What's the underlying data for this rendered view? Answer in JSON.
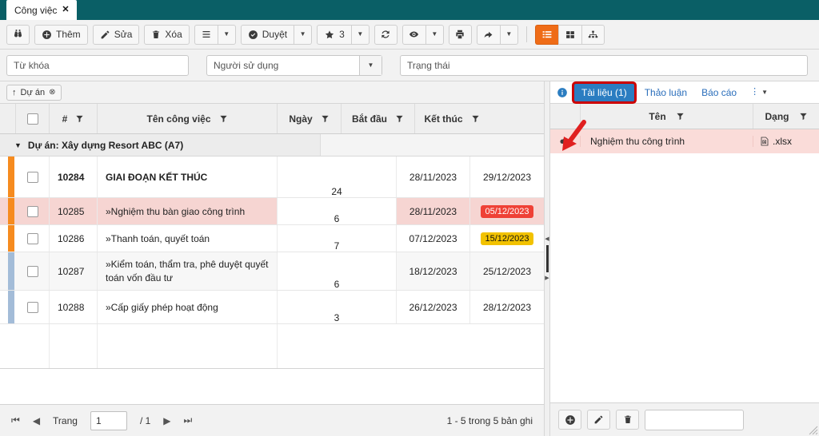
{
  "window": {
    "tab_title": "Công việc",
    "tab_close": "✕"
  },
  "toolbar": {
    "search_icon": "binoculars-icon",
    "add_label": "Thêm",
    "edit_label": "Sửa",
    "delete_label": "Xóa",
    "menu_icon": "hamburger-icon",
    "approve_label": "Duyệt",
    "star_count": "3",
    "refresh_icon": "refresh-icon",
    "eye_icon": "eye-icon",
    "print_icon": "printer-icon",
    "share_icon": "share-arrow-icon",
    "view_list_icon": "list-view-icon",
    "view_grid_icon": "grid-view-icon",
    "view_tree_icon": "tree-view-icon",
    "caret": "▼"
  },
  "filters": {
    "keyword_placeholder": "Từ khóa",
    "keyword_value": "",
    "user_value": "Người sử dụng",
    "status_value": "Trạng thái"
  },
  "group_chip": {
    "arrow": "↑",
    "label": "Dự án",
    "close": "✕"
  },
  "grid": {
    "columns": {
      "num": "#",
      "name": "Tên công việc",
      "days": "Ngày",
      "start": "Bắt đầu",
      "end": "Kết thúc"
    },
    "group_label": "Dự án: Xây dựng Resort ABC (A7)",
    "group_toggle": "▼",
    "rows": [
      {
        "id": "10284",
        "name": "GIAI ĐOẠN KẾT THÚC",
        "days": "24",
        "start": "28/11/2023",
        "end": "29/12/2023",
        "bold": true,
        "bar": "orange",
        "highlight": "none",
        "end_badge": "none"
      },
      {
        "id": "10285",
        "name": "»Nghiệm thu bàn giao công trình",
        "days": "6",
        "start": "28/11/2023",
        "end": "05/12/2023",
        "bold": false,
        "bar": "orange",
        "highlight": "selected",
        "end_badge": "red"
      },
      {
        "id": "10286",
        "name": "»Thanh toán, quyết toán",
        "days": "7",
        "start": "07/12/2023",
        "end": "15/12/2023",
        "bold": false,
        "bar": "orange",
        "highlight": "none",
        "end_badge": "yellow"
      },
      {
        "id": "10287",
        "name": "»Kiểm toán, thẩm tra, phê duyệt quyết toán vốn đầu tư",
        "days": "6",
        "start": "18/12/2023",
        "end": "25/12/2023",
        "bold": false,
        "bar": "blue",
        "highlight": "alt",
        "end_badge": "none"
      },
      {
        "id": "10288",
        "name": "»Cấp giấy phép hoạt động",
        "days": "3",
        "start": "26/12/2023",
        "end": "28/12/2023",
        "bold": false,
        "bar": "blue",
        "highlight": "none",
        "end_badge": "none"
      }
    ]
  },
  "pager": {
    "first_icon": "⏮",
    "prev_icon": "◀",
    "page_label": "Trang",
    "page_value": "1",
    "page_total": "/ 1",
    "next_icon": "▶",
    "last_icon": "⏭",
    "summary": "1 - 5 trong 5 bản ghi"
  },
  "right_panel": {
    "info_icon": "info-icon",
    "tabs": [
      {
        "label": "Tài liệu (1)",
        "active": true
      },
      {
        "label": "Thảo luận",
        "active": false
      },
      {
        "label": "Báo cáo",
        "active": false
      }
    ],
    "overflow_icon": "kebab-menu-icon",
    "overflow_caret": "▼",
    "columns": {
      "name": "Tên",
      "type": "Dạng"
    },
    "documents": [
      {
        "download_icon": "cloud-download-icon",
        "name": "Nghiệm thu công trình",
        "type_icon": "excel-file-icon",
        "type": ".xlsx"
      }
    ],
    "footer": {
      "add_icon": "plus-circle-icon",
      "edit_icon": "pencil-icon",
      "delete_icon": "trash-icon",
      "input_value": ""
    }
  },
  "colors": {
    "header_teal": "#0a5f66",
    "accent_orange": "#ef6c17",
    "tab_blue": "#2b7dc1",
    "annotation_red": "#cc0000",
    "badge_red": "#ef4136",
    "badge_yellow": "#f2c200",
    "row_selected": "#f6d5d2",
    "bar_orange": "#f68b1f",
    "bar_blue": "#a3bcd8"
  }
}
